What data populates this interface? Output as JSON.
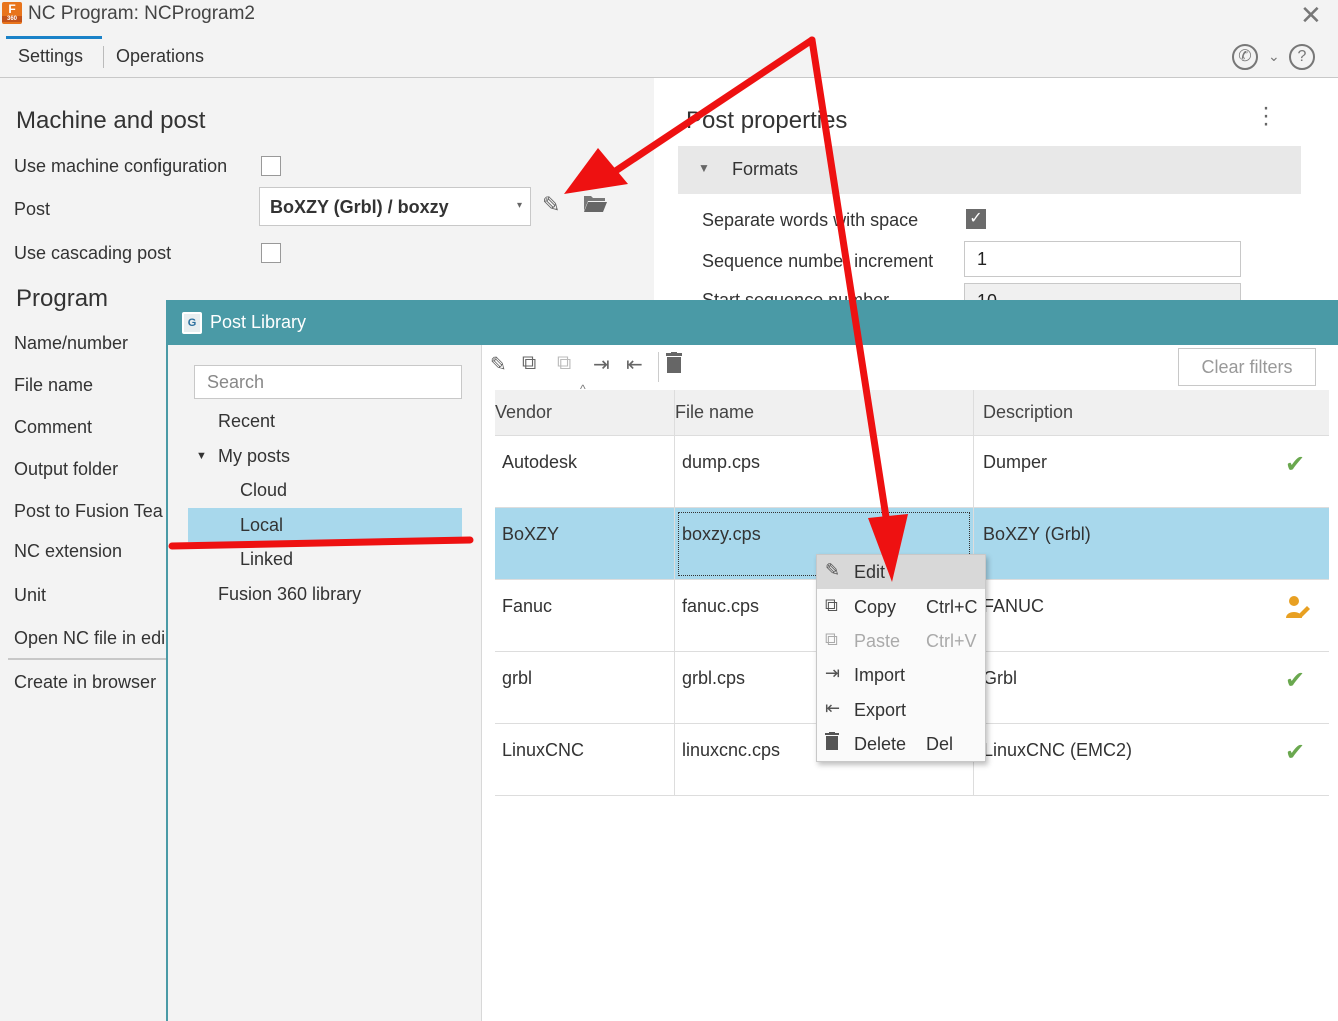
{
  "window": {
    "title": "NC Program: NCProgram2",
    "app_icon_text": "F",
    "app_icon_sub": "360"
  },
  "tabs": [
    {
      "label": "Settings",
      "active": true
    },
    {
      "label": "Operations",
      "active": false
    }
  ],
  "header_icons": [
    "phone-icon",
    "chevron-down-icon",
    "help-icon"
  ],
  "machine_and_post": {
    "title": "Machine and post",
    "use_machine_configuration": {
      "label": "Use machine configuration",
      "checked": false
    },
    "post": {
      "label": "Post",
      "value": "BoXZY (Grbl) / boxzy"
    },
    "use_cascading_post": {
      "label": "Use cascading post",
      "checked": false
    }
  },
  "program": {
    "title": "Program",
    "fields": [
      "Name/number",
      "File name",
      "Comment",
      "Output folder",
      "Post to Fusion Tea",
      "NC extension",
      "Unit",
      "Open NC file in edi",
      "Create in browser"
    ]
  },
  "post_properties": {
    "title": "Post properties",
    "formats_label": "Formats",
    "separate_words": {
      "label": "Separate words with space",
      "checked": true
    },
    "sequence_increment": {
      "label": "Sequence number increment",
      "value": "1"
    },
    "partial_label": "Start sequence number",
    "partial_value": "10"
  },
  "post_library": {
    "title": "Post Library",
    "search_placeholder": "Search",
    "tree": {
      "recent": "Recent",
      "my_posts": "My posts",
      "cloud": "Cloud",
      "local": "Local",
      "linked": "Linked",
      "fusion_library": "Fusion 360 library"
    },
    "clear_filters": "Clear filters",
    "columns": {
      "vendor": "Vendor",
      "file_name": "File name",
      "description": "Description"
    },
    "rows": [
      {
        "vendor": "Autodesk",
        "file": "dump.cps",
        "description": "Dumper",
        "status": "check-icon"
      },
      {
        "vendor": "BoXZY",
        "file": "boxzy.cps",
        "description": "BoXZY (Grbl)",
        "status": "",
        "selected": true
      },
      {
        "vendor": "Fanuc",
        "file": "fanuc.cps",
        "description": "FANUC",
        "status": "user-edit-icon"
      },
      {
        "vendor": "grbl",
        "file": "grbl.cps",
        "description": "Grbl",
        "status": "check-icon"
      },
      {
        "vendor": "LinuxCNC",
        "file": "linuxcnc.cps",
        "description": "LinuxCNC (EMC2)",
        "status": "check-icon"
      }
    ]
  },
  "context_menu": {
    "items": [
      {
        "label": "Edit",
        "shortcut": "",
        "icon": "pencil-icon",
        "enabled": true,
        "hover": true
      },
      {
        "label": "Copy",
        "shortcut": "Ctrl+C",
        "icon": "copy-icon",
        "enabled": true
      },
      {
        "label": "Paste",
        "shortcut": "Ctrl+V",
        "icon": "paste-icon",
        "enabled": false
      },
      {
        "label": "Import",
        "shortcut": "",
        "icon": "import-icon",
        "enabled": true
      },
      {
        "label": "Export",
        "shortcut": "",
        "icon": "export-icon",
        "enabled": true
      },
      {
        "label": "Delete",
        "shortcut": "Del",
        "icon": "trash-icon",
        "enabled": true
      }
    ]
  },
  "colors": {
    "accent": "#1a82c8",
    "dialog_title": "#4a9aa6",
    "selection": "#a8d8ec",
    "annotation": "#ee1111",
    "ok": "#6aa84f"
  }
}
